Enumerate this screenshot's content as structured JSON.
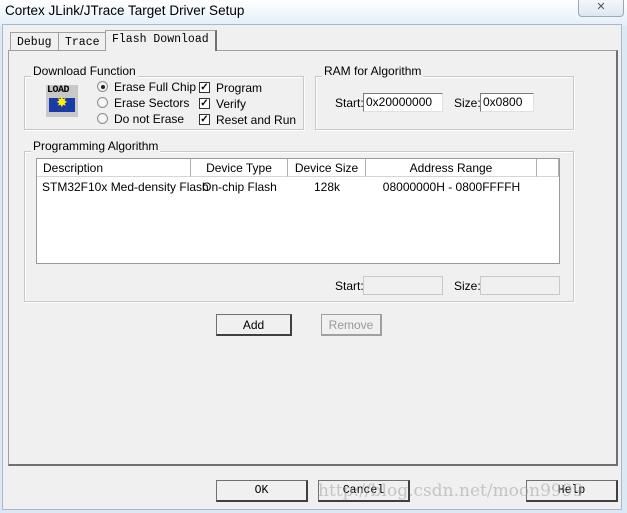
{
  "window": {
    "title": "Cortex JLink/JTrace Target Driver Setup",
    "close_glyph": "✕"
  },
  "tabs": [
    {
      "label": "Debug"
    },
    {
      "label": "Trace"
    },
    {
      "label": "Flash Download",
      "active": true
    }
  ],
  "download_function": {
    "label": "Download Function",
    "icon_text": "LOAD",
    "radios": [
      {
        "label": "Erase Full Chip",
        "selected": true
      },
      {
        "label": "Erase Sectors",
        "selected": false
      },
      {
        "label": "Do not Erase",
        "selected": false
      }
    ],
    "checks": [
      {
        "label": "Program",
        "checked": true
      },
      {
        "label": "Verify",
        "checked": true
      },
      {
        "label": "Reset and Run",
        "checked": true
      }
    ]
  },
  "ram": {
    "label": "RAM for Algorithm",
    "start_label": "Start:",
    "start_value": "0x20000000",
    "size_label": "Size:",
    "size_value": "0x0800"
  },
  "programming": {
    "label": "Programming Algorithm",
    "columns": [
      "Description",
      "Device Type",
      "Device Size",
      "Address Range"
    ],
    "rows": [
      [
        "STM32F10x Med-density Flash",
        "On-chip Flash",
        "128k",
        "08000000H - 0800FFFFH"
      ]
    ],
    "start_label": "Start:",
    "start_value": "",
    "size_label": "Size:",
    "size_value": "",
    "add_label": "Add",
    "remove_label": "Remove"
  },
  "footer": {
    "ok": "OK",
    "cancel": "Cancel",
    "help": "Help"
  },
  "watermark": "http://blog.csdn.net/moon9999"
}
